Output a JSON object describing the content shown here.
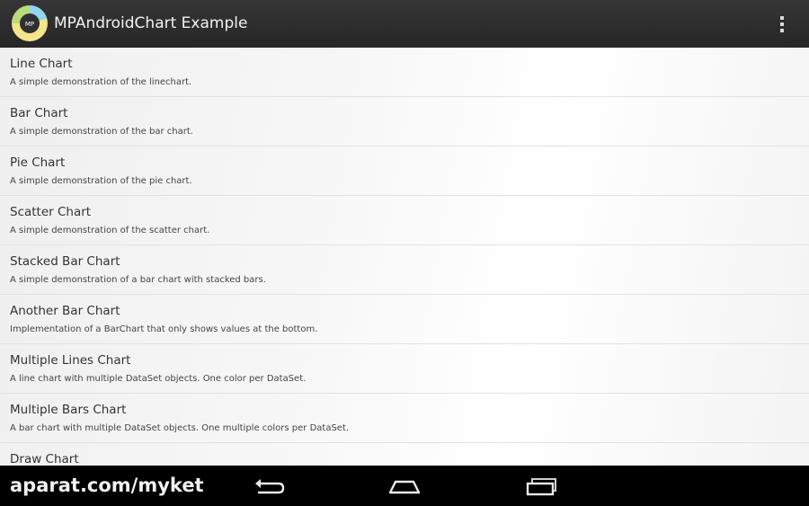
{
  "action_bar": {
    "title": "MPAndroidChart Example",
    "logo_text": "MP",
    "icon": "app-logo-icon",
    "overflow_icon": "overflow-menu-icon"
  },
  "list": {
    "items": [
      {
        "title": "Line Chart",
        "description": "A simple demonstration of the linechart."
      },
      {
        "title": "Bar Chart",
        "description": "A simple demonstration of the bar chart."
      },
      {
        "title": "Pie Chart",
        "description": "A simple demonstration of the pie chart."
      },
      {
        "title": "Scatter Chart",
        "description": "A simple demonstration of the scatter chart."
      },
      {
        "title": "Stacked Bar Chart",
        "description": "A simple demonstration of a bar chart with stacked bars."
      },
      {
        "title": "Another Bar Chart",
        "description": "Implementation of a BarChart that only shows values at the bottom."
      },
      {
        "title": "Multiple Lines Chart",
        "description": "A line chart with multiple DataSet objects. One color per DataSet."
      },
      {
        "title": "Multiple Bars Chart",
        "description": "A bar chart with multiple DataSet objects. One multiple colors per DataSet."
      },
      {
        "title": "Draw Chart",
        "description": ""
      }
    ]
  },
  "nav_bar": {
    "watermark": "aparat.com/myket",
    "back_icon": "back-icon",
    "home_icon": "home-icon",
    "recents_icon": "recent-apps-icon"
  },
  "colors": {
    "action_bar": "#2e2e2e",
    "list_background": "#f5f5f5",
    "title_text": "#333333",
    "logo_green": "#b9dc78",
    "logo_yellow": "#f3e58a",
    "logo_cyan": "#8fd6ee"
  }
}
